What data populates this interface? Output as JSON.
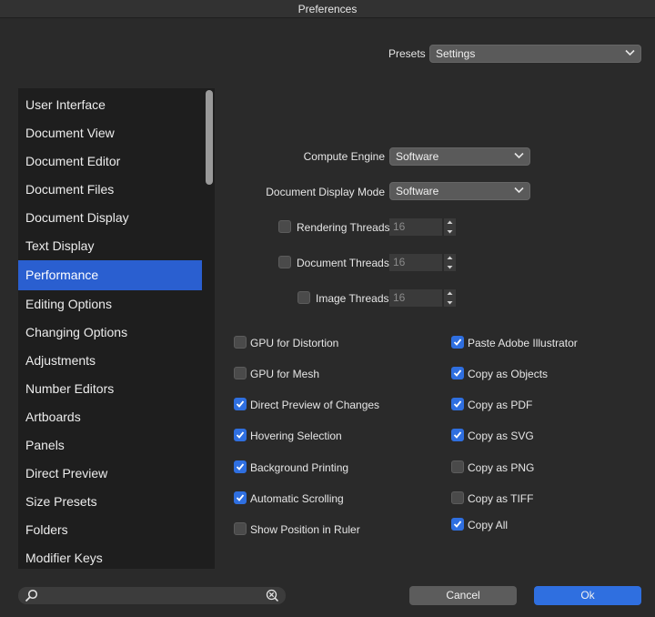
{
  "window": {
    "title": "Preferences"
  },
  "presets": {
    "label": "Presets",
    "value": "Settings"
  },
  "sidebar": {
    "items": [
      {
        "label": "User Interface"
      },
      {
        "label": "Document View"
      },
      {
        "label": "Document Editor"
      },
      {
        "label": "Document Files"
      },
      {
        "label": "Document Display"
      },
      {
        "label": "Text Display"
      },
      {
        "label": "Performance",
        "active": true
      },
      {
        "label": "Editing Options"
      },
      {
        "label": "Changing Options"
      },
      {
        "label": "Adjustments"
      },
      {
        "label": "Number Editors"
      },
      {
        "label": "Artboards"
      },
      {
        "label": "Panels"
      },
      {
        "label": "Direct Preview"
      },
      {
        "label": "Size Presets"
      },
      {
        "label": "Folders"
      },
      {
        "label": "Modifier Keys"
      }
    ]
  },
  "performance": {
    "compute_engine": {
      "label": "Compute Engine",
      "value": "Software"
    },
    "document_display_mode": {
      "label": "Document Display Mode",
      "value": "Software"
    },
    "rendering_threads": {
      "label": "Rendering Threads",
      "value": "16",
      "checked": false
    },
    "document_threads": {
      "label": "Document Threads",
      "value": "16",
      "checked": false
    },
    "image_threads": {
      "label": "Image Threads",
      "value": "16",
      "checked": false
    },
    "left_options": [
      {
        "label": "GPU for Distortion",
        "checked": false
      },
      {
        "label": "GPU for Mesh",
        "checked": false
      },
      {
        "label": "Direct Preview of Changes",
        "checked": true
      },
      {
        "label": "Hovering Selection",
        "checked": true
      },
      {
        "label": "Background Printing",
        "checked": true
      },
      {
        "label": "Automatic Scrolling",
        "checked": true
      },
      {
        "label": "Show Position in Ruler",
        "checked": false
      }
    ],
    "right_options": [
      {
        "label": "Paste Adobe Illustrator",
        "checked": true
      },
      {
        "label": "Copy as Objects",
        "checked": true
      },
      {
        "label": "Copy as PDF",
        "checked": true
      },
      {
        "label": "Copy as SVG",
        "checked": true
      },
      {
        "label": "Copy as PNG",
        "checked": false
      },
      {
        "label": "Copy as TIFF",
        "checked": false
      },
      {
        "label": "Copy All",
        "checked": true
      }
    ]
  },
  "search": {
    "placeholder": ""
  },
  "buttons": {
    "cancel": "Cancel",
    "ok": "Ok"
  },
  "colors": {
    "accent": "#2f6fe0",
    "sidebar_active": "#2a5fd0"
  },
  "icons": {
    "search": "magnifier-icon",
    "clear": "clear-circle-icon"
  }
}
